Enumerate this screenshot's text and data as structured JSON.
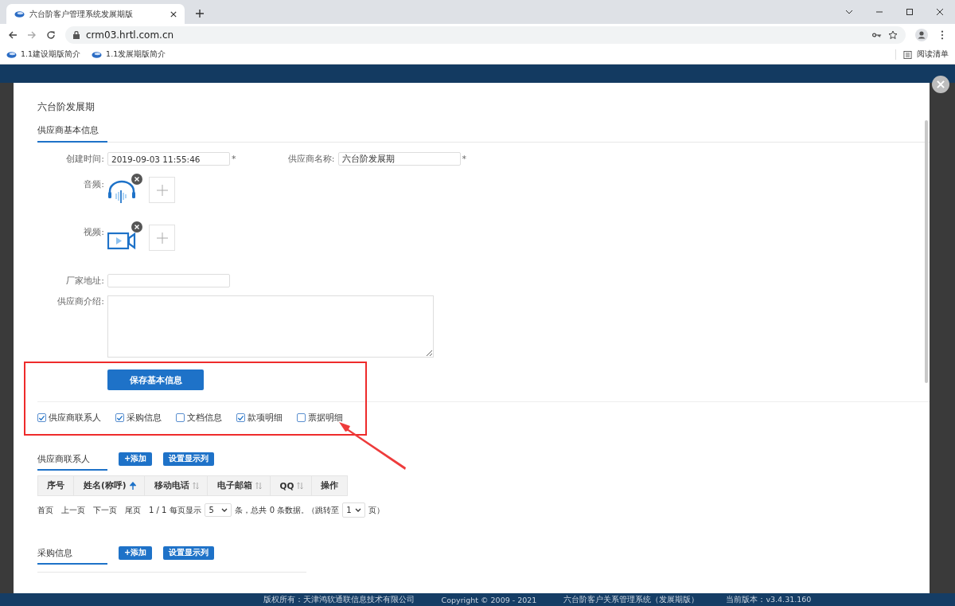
{
  "browser": {
    "tab_title": "六台阶客户管理系统发展期版",
    "url": "crm03.hrtl.com.cn",
    "bookmarks": [
      "1.1建设期版简介",
      "1.1发展期版简介"
    ],
    "reading_list": "阅读清单"
  },
  "modal": {
    "title": "六台阶发展期",
    "tab": "供应商基本信息",
    "created": {
      "label": "创建时间:",
      "value": "2019-09-03 11:55:46",
      "required_mark": "*"
    },
    "supplier_name": {
      "label": "供应商名称:",
      "value": "六台阶发展期",
      "required_mark": "*"
    },
    "audio_label": "音频:",
    "video_label": "视频:",
    "address": {
      "label": "厂家地址:"
    },
    "intro": {
      "label": "供应商介绍:"
    },
    "save_button": "保存基本信息",
    "checkboxes": [
      {
        "label": "供应商联系人",
        "checked": true
      },
      {
        "label": "采购信息",
        "checked": true
      },
      {
        "label": "文档信息",
        "checked": false
      },
      {
        "label": "款项明细",
        "checked": true
      },
      {
        "label": "票据明细",
        "checked": false
      }
    ],
    "contacts": {
      "title": "供应商联系人",
      "add": "+添加",
      "columns_button": "设置显示列",
      "columns": [
        {
          "label": "序号",
          "sortable": false,
          "sorted": false
        },
        {
          "label": "姓名(称呼)",
          "sortable": true,
          "sorted": true
        },
        {
          "label": "移动电话",
          "sortable": true,
          "sorted": false
        },
        {
          "label": "电子邮箱",
          "sortable": true,
          "sorted": false
        },
        {
          "label": "QQ",
          "sortable": true,
          "sorted": false
        },
        {
          "label": "操作",
          "sortable": false,
          "sorted": false
        }
      ],
      "pager": {
        "first": "首页",
        "prev": "上一页",
        "next": "下一页",
        "last": "尾页",
        "page": "1 / 1",
        "per_page_label": "每页显示",
        "per_page": "5",
        "total": "条，总共 0 条数据。",
        "jump_label": "（跳转至",
        "jump_page": "1",
        "jump_end": "页）"
      }
    },
    "purchases": {
      "title": "采购信息",
      "add": "+添加",
      "columns_button": "设置显示列"
    }
  },
  "footer": [
    "版权所有：天津鸿软通联信息技术有限公司",
    "Copyright © 2009 - 2021",
    "六台阶客户关系管理系统（发展期版）",
    "当前版本：v3.4.31.160"
  ]
}
